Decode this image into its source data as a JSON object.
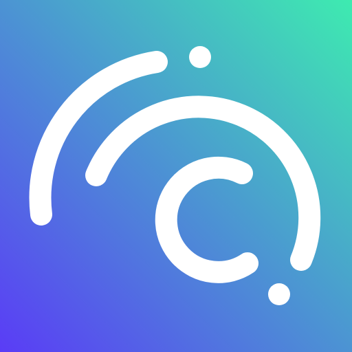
{
  "app_icon": {
    "gradient": {
      "top_right": "#3EEBB0",
      "bottom_left": "#5A3CF6"
    },
    "foreground": "#FFFFFF",
    "icon": "c-orbit-logo-icon"
  }
}
